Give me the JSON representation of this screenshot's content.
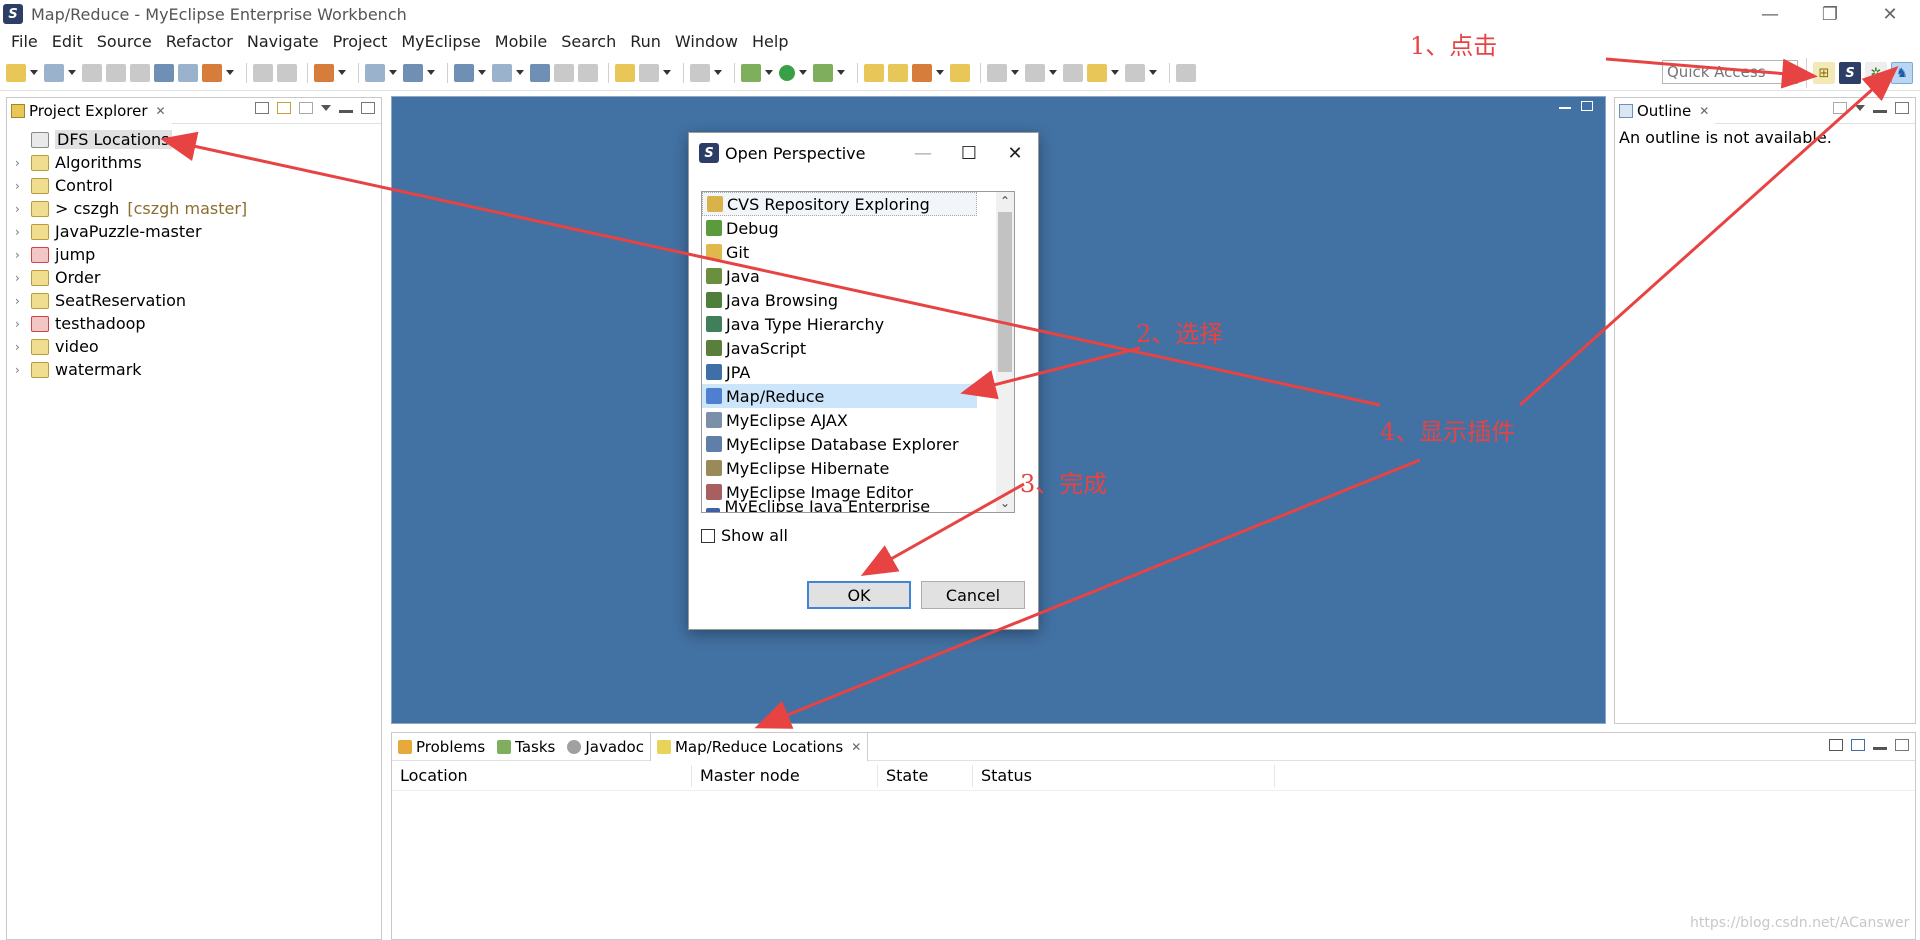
{
  "window": {
    "title": "Map/Reduce - MyEclipse Enterprise Workbench",
    "controls": [
      "—",
      "❐",
      "✕"
    ]
  },
  "menu": [
    "File",
    "Edit",
    "Source",
    "Refactor",
    "Navigate",
    "Project",
    "MyEclipse",
    "Mobile",
    "Search",
    "Run",
    "Window",
    "Help"
  ],
  "toolbar": {
    "quick_access_placeholder": "Quick Access"
  },
  "project_explorer": {
    "tab_label": "Project Explorer",
    "items": [
      {
        "label": "DFS Locations",
        "expandable": false,
        "icon": "dfs-icon"
      },
      {
        "label": "Algorithms",
        "expandable": true,
        "icon": "java-project-icon"
      },
      {
        "label": "Control",
        "expandable": true,
        "icon": "java-project-icon"
      },
      {
        "label": "> cszgh",
        "decoration": "[cszgh master]",
        "expandable": true,
        "icon": "git-project-icon"
      },
      {
        "label": "JavaPuzzle-master",
        "expandable": true,
        "icon": "java-project-icon"
      },
      {
        "label": "jump",
        "expandable": true,
        "icon": "error-project-icon"
      },
      {
        "label": "Order",
        "expandable": true,
        "icon": "java-project-icon"
      },
      {
        "label": "SeatReservation",
        "expandable": true,
        "icon": "java-project-icon"
      },
      {
        "label": "testhadoop",
        "expandable": true,
        "icon": "error-project-icon"
      },
      {
        "label": "video",
        "expandable": true,
        "icon": "java-project-icon"
      },
      {
        "label": "watermark",
        "expandable": true,
        "icon": "java-project-icon"
      }
    ]
  },
  "outline": {
    "tab_label": "Outline",
    "message": "An outline is not available."
  },
  "bottom_panel": {
    "tabs": [
      {
        "label": "Problems",
        "icon": "problems-icon"
      },
      {
        "label": "Tasks",
        "icon": "tasks-icon"
      },
      {
        "label": "Javadoc",
        "icon": "javadoc-icon"
      },
      {
        "label": "Map/Reduce Locations",
        "icon": "mapreduce-locations-icon",
        "active": true
      }
    ],
    "columns": [
      "Location",
      "Master node",
      "State",
      "Status"
    ]
  },
  "dialog": {
    "title": "Open Perspective",
    "items": [
      {
        "label": "CVS Repository Exploring",
        "color": "#d9b34a"
      },
      {
        "label": "Debug",
        "color": "#5a9b3c"
      },
      {
        "label": "Git",
        "color": "#e0b84b"
      },
      {
        "label": "Java",
        "color": "#6a8f3f"
      },
      {
        "label": "Java Browsing",
        "color": "#4f7f3a"
      },
      {
        "label": "Java Type Hierarchy",
        "color": "#3f7f5a"
      },
      {
        "label": "JavaScript",
        "color": "#5a7f3a"
      },
      {
        "label": "JPA",
        "color": "#3f6fa8"
      },
      {
        "label": "Map/Reduce",
        "color": "#4f7fd0"
      },
      {
        "label": "MyEclipse AJAX",
        "color": "#7a8fa8"
      },
      {
        "label": "MyEclipse Database Explorer",
        "color": "#5f7fa8"
      },
      {
        "label": "MyEclipse Hibernate",
        "color": "#9a8a5a"
      },
      {
        "label": "MyEclipse Image Editor",
        "color": "#a85f5f"
      },
      {
        "label": "MyEclipse Java Enterprise (default)",
        "color": "#3f5fa8"
      }
    ],
    "selected_index": 8,
    "show_all_label": "Show all",
    "ok_label": "OK",
    "cancel_label": "Cancel"
  },
  "annotations": {
    "step1": "1、点击",
    "step2": "2、选择",
    "step3": "3、完成",
    "step4": "4、显示插件",
    "color": "#e84343"
  },
  "watermark": "https://blog.csdn.net/ACanswer"
}
